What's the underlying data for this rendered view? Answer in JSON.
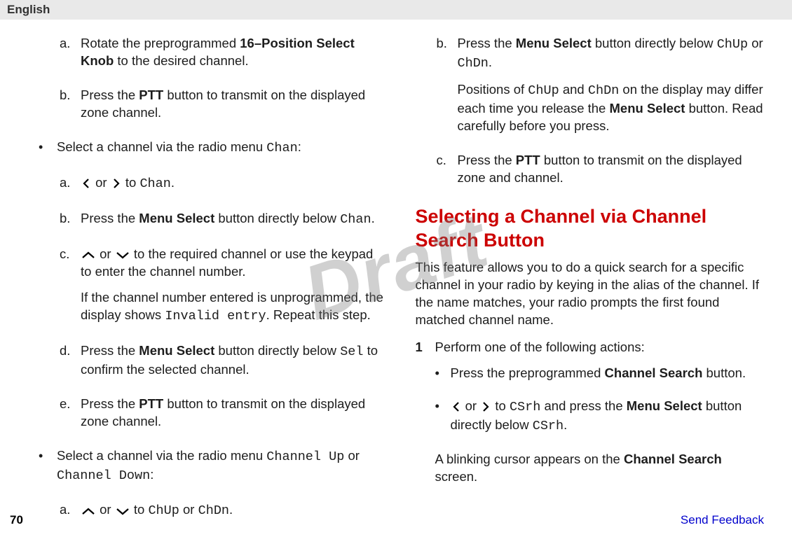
{
  "top": {
    "lang": "English"
  },
  "icons": {
    "left": "<svg class='icon' width='16' height='16' viewBox='0 0 16 16'><polyline points='11,2 5,8 11,14' fill='none' stroke='#000' stroke-width='2.2'/></svg>",
    "right": "<svg class='icon' width='16' height='16' viewBox='0 0 16 16'><polyline points='5,2 11,8 5,14' fill='none' stroke='#000' stroke-width='2.2'/></svg>",
    "up": "<svg class='icon' width='22' height='14' viewBox='0 0 22 14'><polyline points='3,11 11,4 19,11' fill='none' stroke='#000' stroke-width='2.2'/></svg>",
    "down": "<svg class='icon' width='22' height='14' viewBox='0 0 22 14'><polyline points='3,4 11,11 19,4' fill='none' stroke='#000' stroke-width='2.2'/></svg>"
  },
  "left_col": {
    "a1_pre": "Rotate the preprogrammed ",
    "a1_b": "16–Position Select Knob",
    "a1_post": " to the desired channel.",
    "b1_pre": "Press the ",
    "b1_b": "PTT",
    "b1_post": " button to transmit on the displayed zone channel.",
    "bullet1_pre": "Select a channel via the radio menu ",
    "bullet1_chan": "Chan",
    "bullet1_post": ":",
    "a2_or": " or ",
    "a2_to": " to ",
    "a2_chan": "Chan",
    "a2_dot": ".",
    "b2_pre": "Press the ",
    "b2_b": "Menu Select",
    "b2_mid": " button directly below ",
    "b2_chan": "Chan",
    "b2_dot": ".",
    "c2_or": " or ",
    "c2_post": " to the required channel or use the keypad to enter the channel number.",
    "c2_p2_pre": "If the channel number entered is unprogrammed, the display shows ",
    "c2_p2_mono": "Invalid entry",
    "c2_p2_post": ". Repeat this step.",
    "d2_pre": "Press the ",
    "d2_b": "Menu Select",
    "d2_mid": " button directly below ",
    "d2_sel": "Sel",
    "d2_post": " to confirm the selected channel.",
    "e2_pre": "Press the ",
    "e2_b": "PTT",
    "e2_post": " button to transmit on the displayed zone channel.",
    "bullet2_pre": "Select a channel via the radio menu ",
    "bullet2_m1": "Channel Up",
    "bullet2_or": " or ",
    "bullet2_m2": "Channel Down",
    "bullet2_colon": ":",
    "a3_or": " or ",
    "a3_to": " to ",
    "a3_m1": "ChUp",
    "a3_or2": " or ",
    "a3_m2": "ChDn",
    "a3_dot": "."
  },
  "right_col": {
    "b_pre": "Press the ",
    "b_b": "Menu Select",
    "b_mid": " button directly below ",
    "b_m1": "ChUp",
    "b_or": " or ",
    "b_m2": "ChDn",
    "b_dot": ".",
    "b_p2_pre": "Positions of ",
    "b_p2_m1": "ChUp",
    "b_p2_and": " and ",
    "b_p2_m2": "ChDn",
    "b_p2_mid": " on the display may differ each time you release the ",
    "b_p2_b": "Menu Select",
    "b_p2_post": " button. Read carefully before you press.",
    "c_pre": "Press the ",
    "c_b": "PTT",
    "c_post": " button to transmit on the displayed zone and channel.",
    "h2": "Selecting a Channel via Channel Search Button",
    "intro": "This feature allows you to do a quick search for a specific channel in your radio by keying in the alias of the channel. If the name matches, your radio prompts the first found matched channel name.",
    "step1": "Perform one of the following actions:",
    "sub1_pre": "Press the preprogrammed ",
    "sub1_b": "Channel Search",
    "sub1_post": " button.",
    "sub2_or": " or ",
    "sub2_to": " to ",
    "sub2_m": "CSrh",
    "sub2_and": " and press the ",
    "sub2_b": "Menu Select",
    "sub2_mid": " button directly below ",
    "sub2_m2": "CSrh",
    "sub2_dot": ".",
    "result_pre": "A blinking cursor appears on the ",
    "result_b": "Channel Search",
    "result_post": " screen."
  },
  "watermark": "Draft",
  "footer": {
    "page": "70",
    "feedback": "Send Feedback"
  }
}
